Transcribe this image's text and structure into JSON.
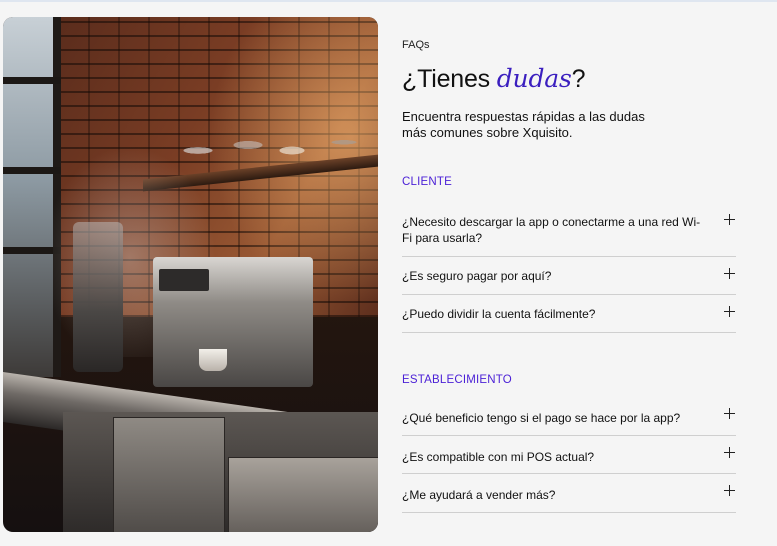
{
  "hero": {
    "image_alt": "Espresso machine on a steel counter in a brick-walled café"
  },
  "faqs": {
    "eyebrow": "FAQs",
    "heading_prefix": "¿Tienes ",
    "heading_accent": "dudas",
    "heading_suffix": "?",
    "intro": "Encuentra respuestas rápidas a las dudas más comunes sobre Xquisito.",
    "accent_color": "#4a1fd6",
    "sections": [
      {
        "title": "CLIENTE",
        "items": [
          {
            "question": "¿Necesito descargar la app o conectarme a una red Wi-Fi para usarla?",
            "toggle_icon": "plus-icon"
          },
          {
            "question": "¿Es seguro pagar por aquí?",
            "toggle_icon": "plus-icon"
          },
          {
            "question": "¿Puedo dividir la cuenta fácilmente?",
            "toggle_icon": "plus-icon"
          }
        ]
      },
      {
        "title": "ESTABLECIMIENTO",
        "items": [
          {
            "question": "¿Qué beneficio tengo si el pago se hace por la app?",
            "toggle_icon": "plus-icon"
          },
          {
            "question": "¿Es compatible con mi POS actual?",
            "toggle_icon": "plus-icon"
          },
          {
            "question": "¿Me ayudará a vender más?",
            "toggle_icon": "plus-icon"
          }
        ]
      }
    ]
  }
}
